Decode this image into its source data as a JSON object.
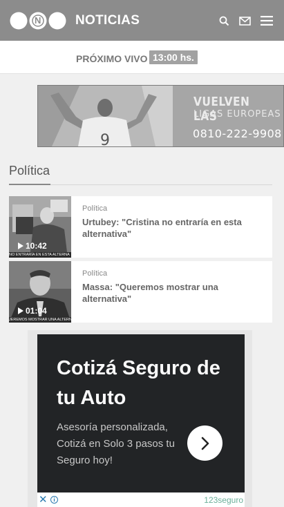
{
  "header": {
    "brand": "NOTICIAS",
    "logo_letter": "N",
    "icons": [
      "search-icon",
      "mail-icon",
      "menu-icon"
    ]
  },
  "live": {
    "label": "PRÓXIMO VIVO",
    "time": "13:00 hs."
  },
  "banner": {
    "line1": "VUELVEN LAS",
    "line2": "LIGAS EUROPEAS",
    "phone": "0810-222-9908",
    "jersey_number": "9"
  },
  "section": {
    "title": "Política"
  },
  "articles": [
    {
      "category": "Política",
      "title": "Urtubey: \"Cristina no entraría en esta alternativa\"",
      "duration": "10:42",
      "caption": "NO ENTRARÍA EN ESTA ALTERNA"
    },
    {
      "category": "Política",
      "title": "Massa: \"Queremos mostrar una alternativa\"",
      "duration": "01:04",
      "caption": "JEREMOS MOSTRAR UNA ALTERNA"
    }
  ],
  "ad": {
    "title": "Cotizá Seguro de tu Auto",
    "body": "Asesoría personalizada, Cotizá en Solo 3 pasos tu Seguro hoy!",
    "close": "✕",
    "info": "i",
    "advertiser": "123seguro"
  },
  "colors": {
    "header_bg": "#8c8c8c",
    "page_bg": "#f0f0f0",
    "ad_bg": "#222426",
    "advertiser": "#6bb09a"
  }
}
